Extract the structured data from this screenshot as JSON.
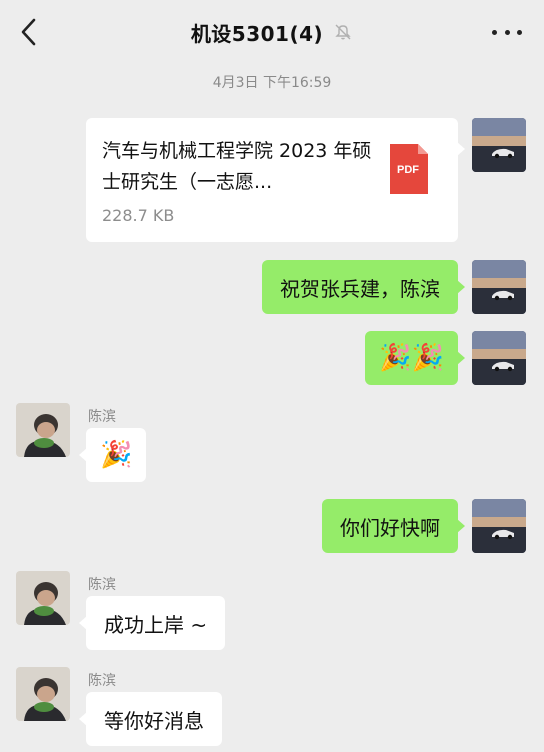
{
  "header": {
    "title": "机设5301(4)",
    "back_icon": "chevron-left-icon",
    "mute_icon": "bell-off-icon",
    "more_icon": "more-dots-icon"
  },
  "timestamp": "4月3日 下午16:59",
  "messages": [
    {
      "type": "file",
      "side": "right",
      "file_name": "汽车与机械工程学院 2023 年硕士研究生（一志愿...",
      "file_size": "228.7 KB",
      "file_type": "PDF"
    },
    {
      "type": "text",
      "side": "right",
      "text": "祝贺张兵建，陈滨"
    },
    {
      "type": "emoji",
      "side": "right",
      "emoji": "🎉🎉"
    },
    {
      "type": "emoji",
      "side": "left",
      "sender": "陈滨",
      "emoji": "🎉"
    },
    {
      "type": "text",
      "side": "right",
      "text": "你们好快啊"
    },
    {
      "type": "text",
      "side": "left",
      "sender": "陈滨",
      "text": "成功上岸 ~"
    },
    {
      "type": "text",
      "side": "left",
      "sender": "陈滨",
      "text": "等你好消息"
    }
  ],
  "colors": {
    "background": "#ededed",
    "self_bubble": "#95ec69",
    "other_bubble": "#ffffff",
    "pdf_red": "#e5473c"
  }
}
